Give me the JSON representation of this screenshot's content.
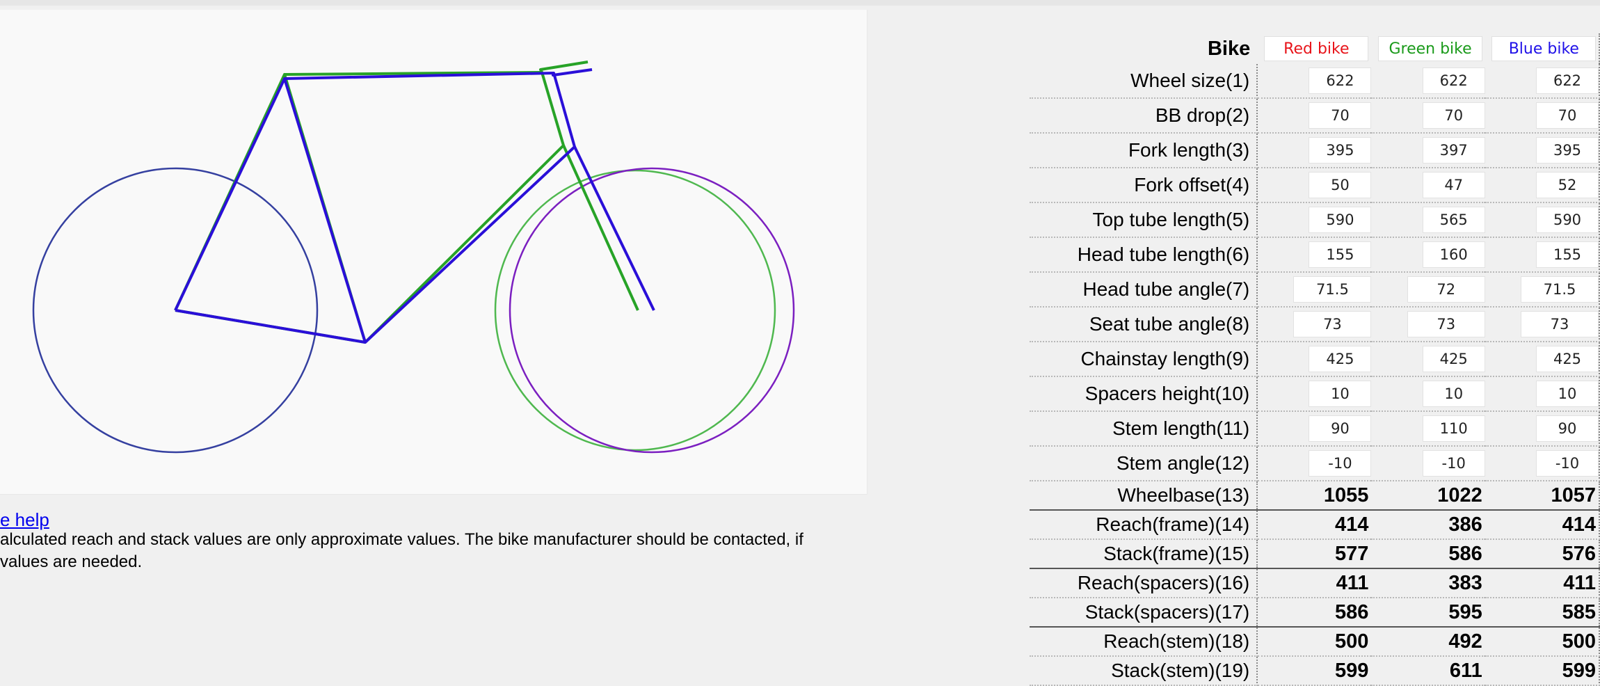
{
  "help_link": "e help",
  "note": "alculated reach and stack values are only approximate values. The bike manufacturer should be contacted, if\n values are needed.",
  "colors": {
    "red_label": "#e8141a",
    "green_label": "#1a9a1a",
    "blue_label": "#1f10e8",
    "green_frame": "#27a327",
    "blue_frame": "#2a0fd8",
    "purple_wheel": "#7b1fc0",
    "navy_wheel": "#3540a0",
    "link": "#0000ee"
  },
  "table": {
    "header_label": "Bike",
    "bikes": [
      "Red bike",
      "Green bike",
      "Blue bike"
    ],
    "input_rows": [
      {
        "label": "Wheel size(1)",
        "values": [
          "622",
          "622",
          "622"
        ]
      },
      {
        "label": "BB drop(2)",
        "values": [
          "70",
          "70",
          "70"
        ]
      },
      {
        "label": "Fork length(3)",
        "values": [
          "395",
          "397",
          "395"
        ]
      },
      {
        "label": "Fork offset(4)",
        "values": [
          "50",
          "47",
          "52"
        ]
      },
      {
        "label": "Top tube length(5)",
        "values": [
          "590",
          "565",
          "590"
        ]
      },
      {
        "label": "Head tube length(6)",
        "values": [
          "155",
          "160",
          "155"
        ]
      },
      {
        "label": "Head tube angle(7)",
        "values": [
          "71.5",
          "72",
          "71.5"
        ]
      },
      {
        "label": "Seat tube angle(8)",
        "values": [
          "73",
          "73",
          "73"
        ]
      },
      {
        "label": "Chainstay length(9)",
        "values": [
          "425",
          "425",
          "425"
        ]
      },
      {
        "label": "Spacers height(10)",
        "values": [
          "10",
          "10",
          "10"
        ]
      },
      {
        "label": "Stem length(11)",
        "values": [
          "90",
          "110",
          "90"
        ]
      },
      {
        "label": "Stem angle(12)",
        "values": [
          "-10",
          "-10",
          "-10"
        ]
      }
    ],
    "result_rows": [
      {
        "label": "Wheelbase(13)",
        "values": [
          "1055",
          "1022",
          "1057"
        ]
      },
      {
        "label": "Reach(frame)(14)",
        "values": [
          "414",
          "386",
          "414"
        ]
      },
      {
        "label": "Stack(frame)(15)",
        "values": [
          "577",
          "586",
          "576"
        ]
      },
      {
        "label": "Reach(spacers)(16)",
        "values": [
          "411",
          "383",
          "411"
        ]
      },
      {
        "label": "Stack(spacers)(17)",
        "values": [
          "586",
          "595",
          "585"
        ]
      },
      {
        "label": "Reach(stem)(18)",
        "values": [
          "500",
          "492",
          "500"
        ]
      },
      {
        "label": "Stack(stem)(19)",
        "values": [
          "599",
          "611",
          "599"
        ]
      }
    ]
  }
}
